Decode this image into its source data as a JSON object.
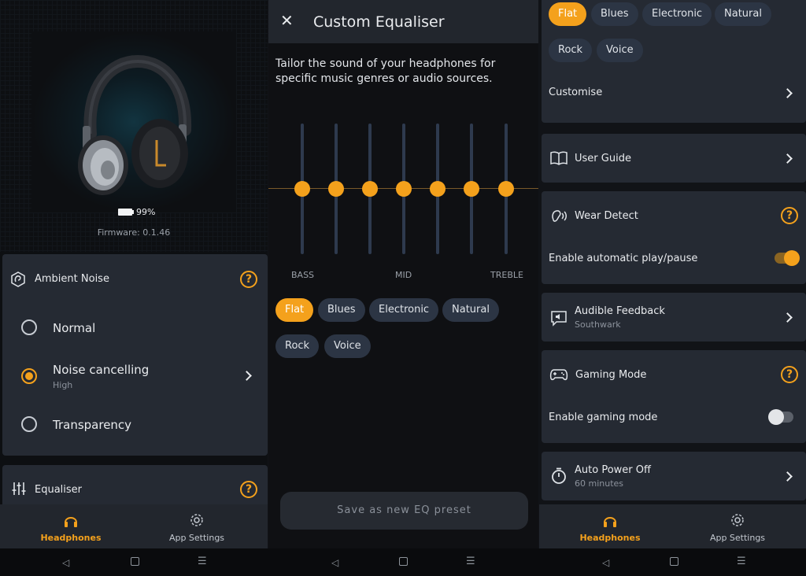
{
  "left": {
    "battery": "99%",
    "firmware": "Firmware: 0.1.46",
    "ambient": {
      "title": "Ambient Noise",
      "help": "?",
      "options": [
        {
          "label": "Normal",
          "sub": ""
        },
        {
          "label": "Noise cancelling",
          "sub": "High"
        },
        {
          "label": "Transparency",
          "sub": ""
        }
      ],
      "selected": "Noise cancelling"
    },
    "equaliser": {
      "title": "Equaliser",
      "help": "?"
    },
    "nav": {
      "headphones": "Headphones",
      "app_settings": "App Settings"
    }
  },
  "mid": {
    "title": "Custom Equaliser",
    "description": "Tailor the sound of your headphones for specific music genres or audio sources.",
    "bands": {
      "bass": "BASS",
      "mid": "MID",
      "treble": "TREBLE"
    },
    "band_levels": [
      0,
      0,
      0,
      0,
      0,
      0,
      0
    ],
    "presets": [
      "Flat",
      "Blues",
      "Electronic",
      "Natural",
      "Rock",
      "Voice"
    ],
    "selected_preset": "Flat",
    "save_button": "Save as new EQ preset"
  },
  "right": {
    "presets": [
      "Flat",
      "Blues",
      "Electronic",
      "Natural",
      "Rock",
      "Voice"
    ],
    "customise": "Customise",
    "user_guide": "User Guide",
    "wear_detect": {
      "title": "Wear Detect",
      "help": "?",
      "toggle_label": "Enable automatic play/pause",
      "enabled": true
    },
    "audible_feedback": {
      "title": "Audible Feedback",
      "sub": "Southwark"
    },
    "gaming_mode": {
      "title": "Gaming Mode",
      "help": "?",
      "toggle_label": "Enable gaming mode",
      "enabled": false
    },
    "auto_power_off": {
      "title": "Auto Power Off",
      "sub": "60 minutes"
    },
    "nav": {
      "headphones": "Headphones",
      "app_settings": "App Settings"
    }
  },
  "colors": {
    "accent": "#f4a11c",
    "card": "#252a33",
    "chip": "#2c3544",
    "nav": "#22262d"
  }
}
